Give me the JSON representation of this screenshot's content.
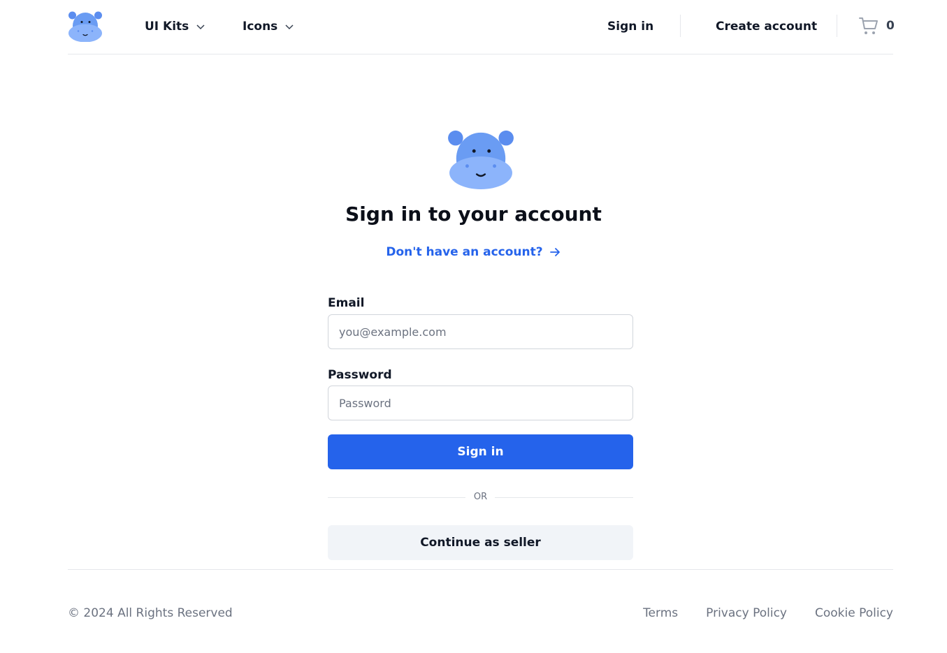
{
  "header": {
    "logo_icon": "hippo-logo-icon",
    "nav": [
      {
        "label": "UI Kits",
        "icon": "chevron-down-icon"
      },
      {
        "label": "Icons",
        "icon": "chevron-down-icon"
      }
    ],
    "sign_in_label": "Sign in",
    "create_account_label": "Create account",
    "cart": {
      "icon": "cart-icon",
      "count": "0"
    }
  },
  "main": {
    "title": "Sign in to your account",
    "signup_link": "Don't have an account?",
    "signup_link_icon": "arrow-right-icon",
    "email": {
      "label": "Email",
      "placeholder": "you@example.com",
      "value": ""
    },
    "password": {
      "label": "Password",
      "placeholder": "Password",
      "value": ""
    },
    "submit_label": "Sign in",
    "divider_text": "OR",
    "seller_label": "Continue as seller"
  },
  "footer": {
    "copyright": "© 2024 All Rights Reserved",
    "links": [
      "Terms",
      "Privacy Policy",
      "Cookie Policy"
    ]
  },
  "colors": {
    "primary": "#2563eb",
    "secondary_button": "#f1f4f8",
    "hippo_dark": "#5b8def",
    "hippo_light": "#8cb4fb"
  }
}
